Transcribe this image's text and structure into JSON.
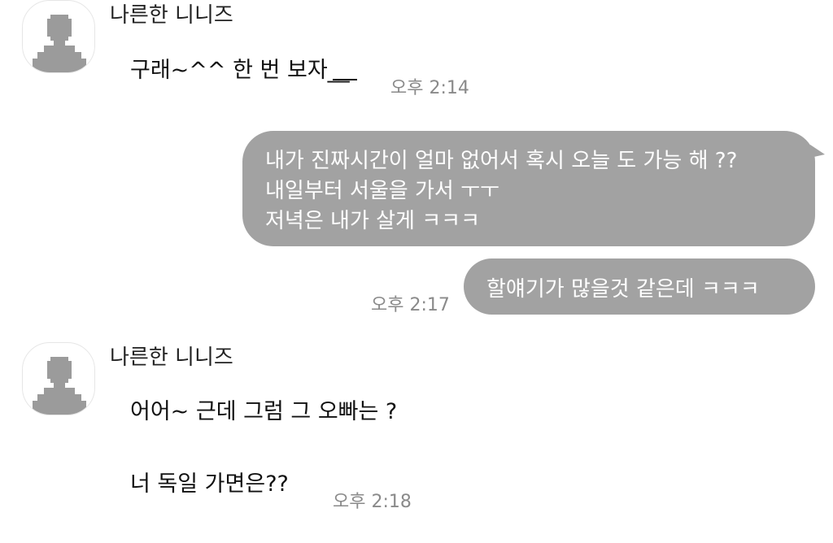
{
  "messages": [
    {
      "sender": "나른한 니니즈",
      "lines": [
        "구래~^^ 한 번 보자__"
      ],
      "time": "오후 2:14"
    },
    {
      "outgoing": true,
      "lines": [
        "내가 진짜시간이 얼마 없어서 혹시 오늘 도 가능 해 ??",
        "내일부터 서울을 가서 ㅜㅜ",
        "저녁은 내가 살게 ㅋㅋㅋ"
      ]
    },
    {
      "outgoing": true,
      "lines": [
        "할얘기가 많을것 같은데 ㅋㅋㅋ"
      ],
      "time": "오후 2:17"
    },
    {
      "sender": "나른한 니니즈",
      "lines": [
        "어어~ 근데 그럼 그 오빠는 ?",
        "너 독일 가면은??"
      ],
      "time": "오후 2:18"
    }
  ],
  "colors": {
    "outgoing_bubble": "#a2a2a2",
    "outgoing_text": "#ffffff",
    "avatar_silhouette": "#9b9b9b",
    "timestamp": "#8a8a8a"
  },
  "icons": {
    "avatar": "default-profile-silhouette-icon"
  }
}
